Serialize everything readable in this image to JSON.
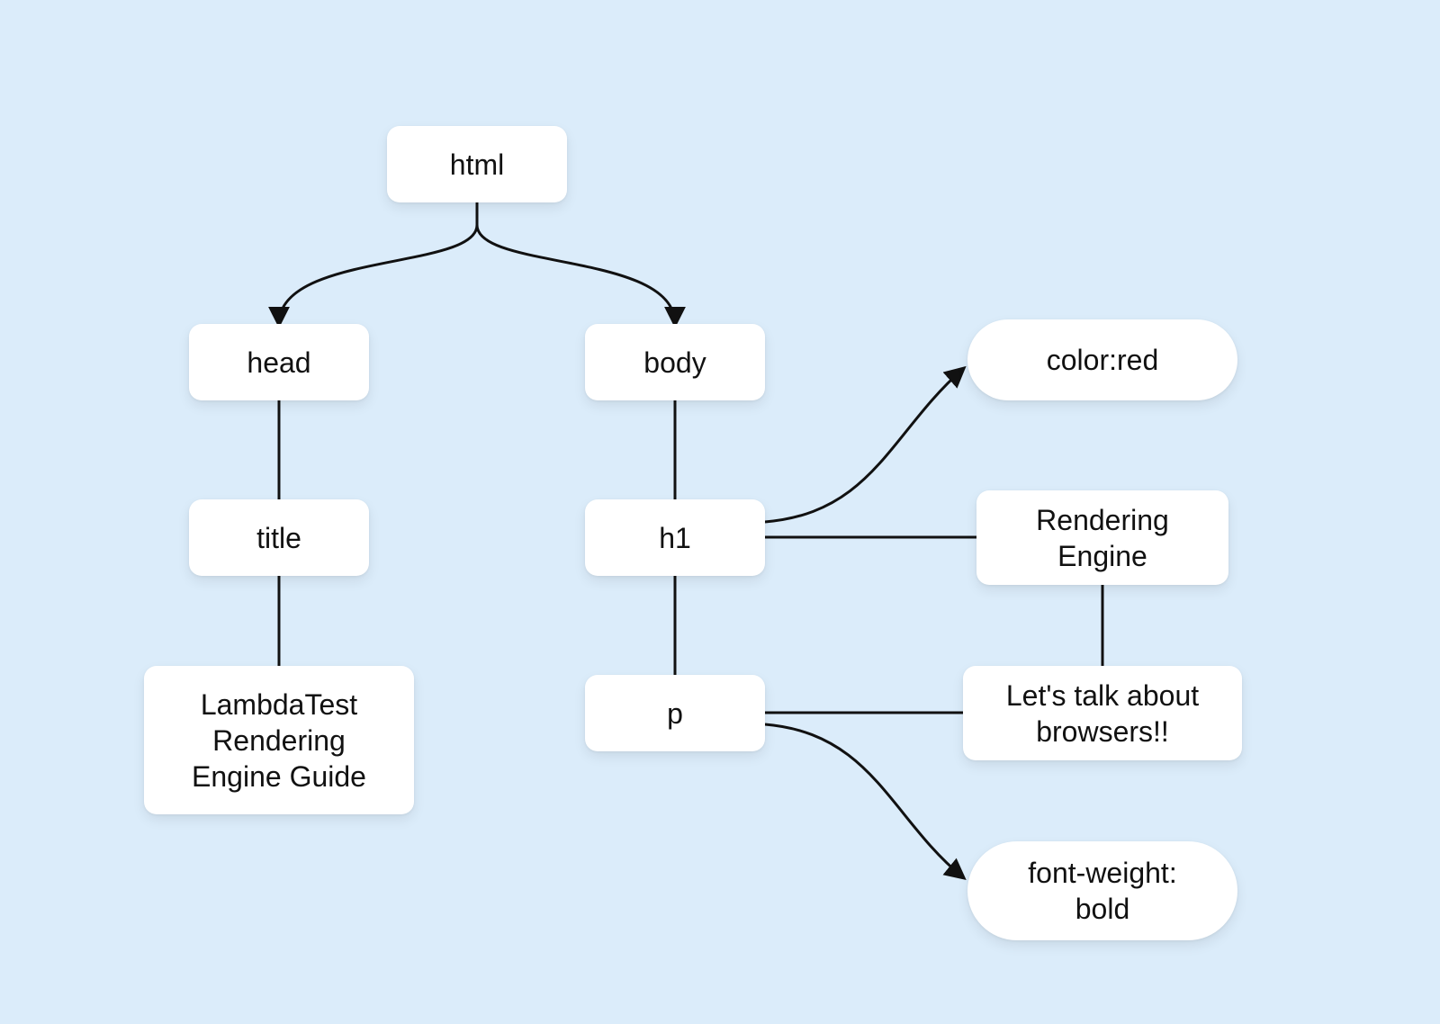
{
  "colors": {
    "background": "#dbecfa",
    "node_bg": "#ffffff",
    "text": "#111111",
    "edge": "#111111"
  },
  "nodes": {
    "html": {
      "label": "html"
    },
    "head": {
      "label": "head"
    },
    "body": {
      "label": "body"
    },
    "title": {
      "label": "title"
    },
    "h1": {
      "label": "h1"
    },
    "p": {
      "label": "p"
    },
    "title_text": {
      "label": "LambdaTest\nRendering\nEngine Guide"
    },
    "h1_text": {
      "label": "Rendering\nEngine"
    },
    "p_text": {
      "label": "Let's talk about\nbrowsers!!"
    },
    "h1_style": {
      "label": "color:red"
    },
    "p_style": {
      "label": "font-weight:\nbold"
    }
  },
  "edges": [
    [
      "html",
      "head",
      "arrow"
    ],
    [
      "html",
      "body",
      "arrow"
    ],
    [
      "head",
      "title",
      "line"
    ],
    [
      "title",
      "title_text",
      "line"
    ],
    [
      "body",
      "h1",
      "line"
    ],
    [
      "h1",
      "p",
      "line"
    ],
    [
      "h1",
      "h1_text",
      "line"
    ],
    [
      "p",
      "p_text",
      "line"
    ],
    [
      "h1",
      "h1_style",
      "arrow"
    ],
    [
      "p",
      "p_style",
      "arrow"
    ],
    [
      "h1_text",
      "p_text",
      "line"
    ]
  ]
}
